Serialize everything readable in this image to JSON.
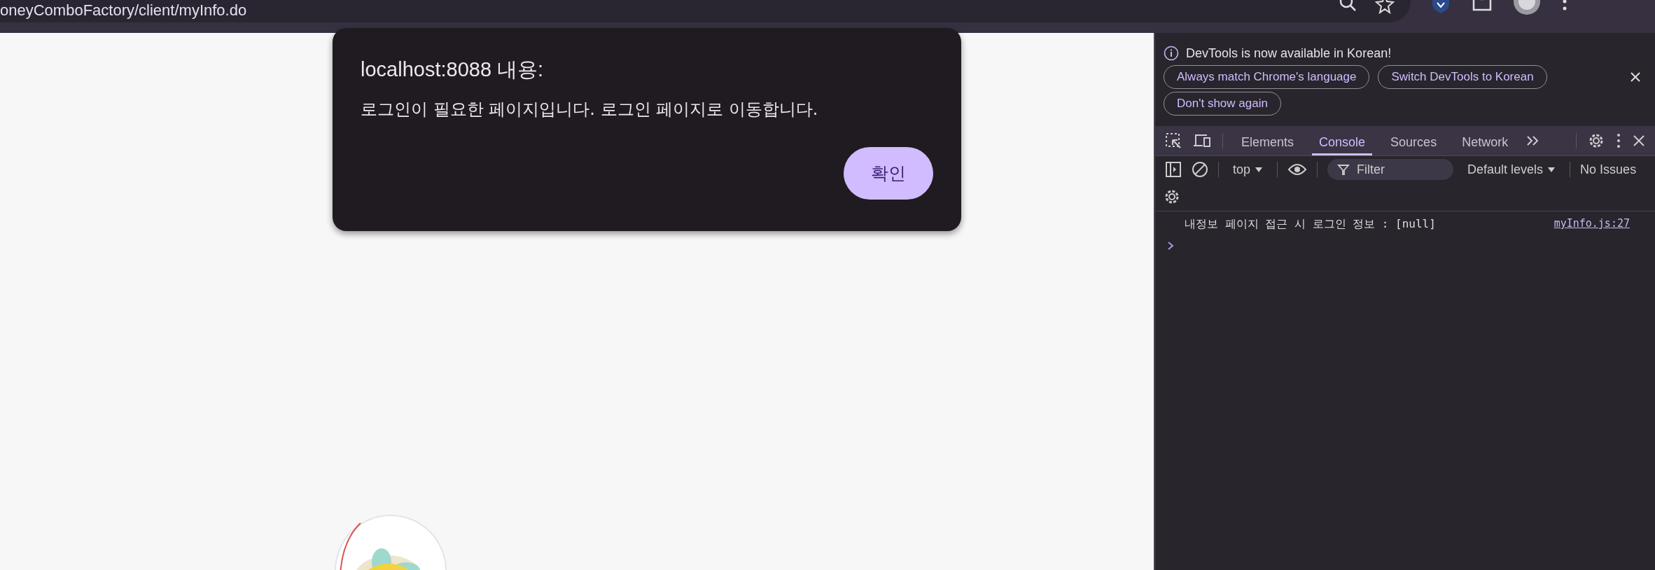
{
  "browser": {
    "url": "oneyComboFactory/client/myInfo.do"
  },
  "dialog": {
    "title": "localhost:8088 내용:",
    "message": "로그인이 필요한 페이지입니다. 로그인 페이지로 이동합니다.",
    "button": "확인"
  },
  "devtools": {
    "infobar": {
      "message": "DevTools is now available in Korean!",
      "buttons": [
        "Always match Chrome's language",
        "Switch DevTools to Korean",
        "Don't show again"
      ]
    },
    "tabs": [
      {
        "label": "Elements",
        "selected": false
      },
      {
        "label": "Console",
        "selected": true
      },
      {
        "label": "Sources",
        "selected": false
      },
      {
        "label": "Network",
        "selected": false
      }
    ],
    "toolbar": {
      "context": "top",
      "filter_placeholder": "Filter",
      "levels": "Default levels",
      "issues": "No Issues"
    },
    "console": {
      "messages": [
        {
          "text": "내정보 페이지 접근 시 로그인 정보 : [null]",
          "source": "myInfo.js:27"
        }
      ]
    }
  }
}
